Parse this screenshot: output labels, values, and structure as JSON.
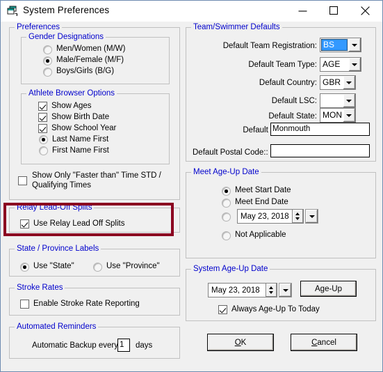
{
  "window": {
    "title": "System Preferences",
    "icon": "window-cascade-icon",
    "minimize": "minimize-icon",
    "maximize": "maximize-icon",
    "close": "close-icon"
  },
  "left": {
    "preferences_legend": "Preferences",
    "gender": {
      "legend": "Gender Designations",
      "options": [
        {
          "label": "Men/Women (M/W)",
          "selected": false
        },
        {
          "label": "Male/Female (M/F)",
          "selected": true
        },
        {
          "label": "Boys/Girls (B/G)",
          "selected": false
        }
      ]
    },
    "athlete_browser": {
      "legend": "Athlete Browser Options",
      "checks": [
        {
          "label": "Show Ages",
          "checked": true
        },
        {
          "label": "Show Birth Date",
          "checked": true
        },
        {
          "label": "Show School Year",
          "checked": true
        }
      ],
      "radios": [
        {
          "label": "Last Name First",
          "selected": true
        },
        {
          "label": "First Name First",
          "selected": false
        }
      ]
    },
    "faster_than": {
      "line1": "Show Only   \"Faster than\" Time STD /",
      "line2": "Qualifying Times",
      "checked": false
    },
    "relay": {
      "legend": "Relay Lead-Off Splits",
      "check_label": "Use Relay Lead Off Splits",
      "checked": true,
      "highlight_color": "#8b0020"
    },
    "state_province": {
      "legend": "State / Province Labels",
      "options": [
        {
          "label": "Use \"State\"",
          "selected": true
        },
        {
          "label": "Use \"Province\"",
          "selected": false
        }
      ]
    },
    "stroke_rates": {
      "legend": "Stroke Rates",
      "check_label": "Enable Stroke Rate Reporting",
      "checked": false
    },
    "reminders": {
      "legend": "Automated Reminders",
      "prefix": "Automatic Backup every",
      "value": "1",
      "suffix": "days"
    }
  },
  "right": {
    "team_defaults": {
      "legend": "Team/Swimmer Defaults",
      "fields": [
        {
          "label": "Default Team Registration:",
          "value": "BS",
          "type": "combo",
          "focused": true
        },
        {
          "label": "Default Team Type:",
          "value": "AGE",
          "type": "combo",
          "focused": false
        },
        {
          "label": "Default Country:",
          "value": "GBR",
          "type": "combo",
          "focused": false
        },
        {
          "label": "Default LSC:",
          "value": "",
          "type": "combo",
          "focused": false
        },
        {
          "label": "Default State:",
          "value": "MON",
          "type": "combo",
          "focused": false
        }
      ],
      "city": {
        "label": "Default City:",
        "value": "Monmouth"
      },
      "postal": {
        "label": "Default Postal Code::",
        "value": ""
      }
    },
    "meet_age_up": {
      "legend": "Meet Age-Up Date",
      "options": [
        {
          "label": "Meet Start Date",
          "selected": true
        },
        {
          "label": "Meet End Date",
          "selected": false
        },
        {
          "label": "",
          "selected": false
        },
        {
          "label": "Not Applicable",
          "selected": false
        }
      ],
      "date": "May 23, 2018"
    },
    "system_age_up": {
      "legend": "System Age-Up Date",
      "date": "May 23, 2018",
      "button": "Age-Up",
      "always_label": "Always Age-Up To Today",
      "always_checked": true
    },
    "buttons": {
      "ok_pre": "",
      "ok_acc": "O",
      "ok_post": "K",
      "cancel_pre": "",
      "cancel_acc": "C",
      "cancel_post": "ancel"
    }
  }
}
